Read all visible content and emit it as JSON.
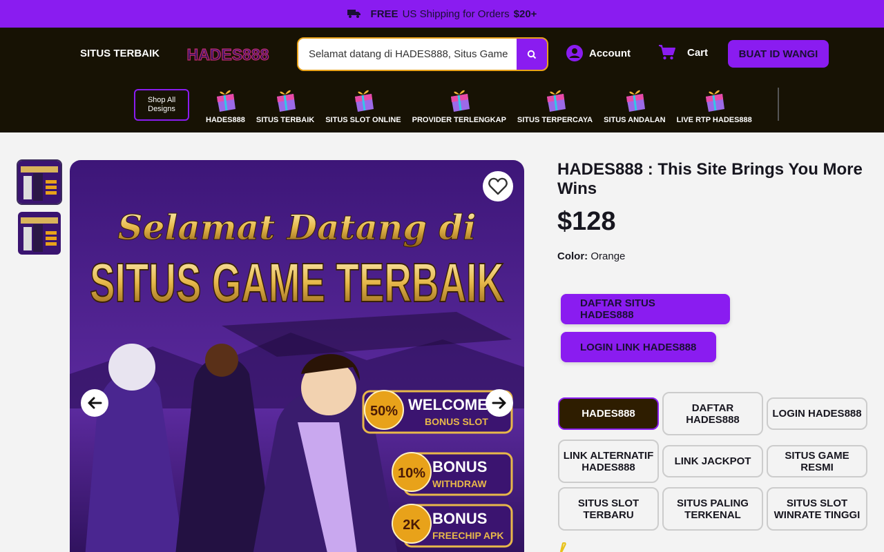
{
  "promo": {
    "free": "FREE",
    "text": "US Shipping for Orders",
    "amount": "$20+"
  },
  "header": {
    "nav_link": "SITUS TERBAIK",
    "logo_text": "HADES888",
    "search_value": "Selamat datang di HADES888, Situs Game",
    "account_label": "Account",
    "cart_label": "Cart",
    "cta_label": "BUAT ID WANGI"
  },
  "categories": {
    "shop_all": "Shop All Designs",
    "items": [
      "HADES888",
      "SITUS TERBAIK",
      "SITUS SLOT ONLINE",
      "PROVIDER TERLENGKAP",
      "SITUS TERPERCAYA",
      "SITUS ANDALAN",
      "LIVE RTP HADES888"
    ]
  },
  "product": {
    "title": "HADES888 : This Site Brings You More Wins",
    "price": "$128",
    "color_label": "Color:",
    "color_value": "Orange",
    "buttons": [
      "DAFTAR SITUS HADES888",
      "LOGIN LINK HADES888"
    ],
    "variants": [
      "HADES888",
      "DAFTAR HADES888",
      "LOGIN HADES888",
      "LINK ALTERNATIF HADES888",
      "LINK JACKPOT",
      "SITUS GAME RESMI",
      "SITUS SLOT TERBARU",
      "SITUS PALING TERKENAL",
      "SITUS SLOT WINRATE TINGGI"
    ],
    "selected_variant": "HADES888"
  },
  "banner": {
    "line1": "Selamat Datang di",
    "line2": "SITUS GAME TERBAIK",
    "badge1_pct": "50%",
    "badge1_a": "WELCOME",
    "badge1_b": "BONUS SLOT",
    "badge2_pct": "10%",
    "badge2_a": "BONUS",
    "badge2_b": "WITHDRAW",
    "badge3_pct": "2K",
    "badge3_a": "BONUS",
    "badge3_b": "FREECHIP APK"
  },
  "colors": {
    "accent": "#8a1cf0",
    "header_bg": "#171204",
    "selected_chip": "#2e1d00"
  }
}
